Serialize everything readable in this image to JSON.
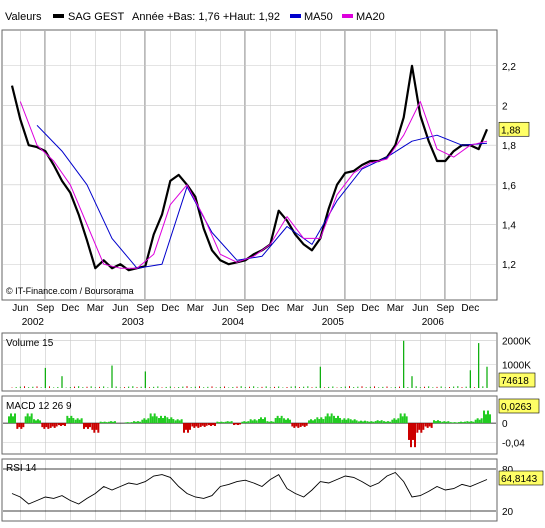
{
  "header": {
    "label": "Valeurs",
    "instrument": "SAG GEST",
    "range_text": "Année +Bas: 1,76 +Haut: 1,92",
    "ma50_label": "MA50",
    "ma20_label": "MA20"
  },
  "copyright": "© IT-Finance.com / Boursorama",
  "colors": {
    "price": "#000000",
    "ma50": "#0000cc",
    "ma20": "#dd00dd",
    "volume_up": "#00aa00",
    "volume_down": "#cc0000",
    "macd_pos": "#22cc22",
    "macd_neg": "#cc0000",
    "rsi": "#000000",
    "highlight_box": "#ffff66",
    "grid": "#c8c8c8",
    "year_divider": "#999999"
  },
  "chart_data": [
    {
      "name": "price",
      "type": "line",
      "x_axis": {
        "months": [
          "Jun",
          "Sep",
          "Dec",
          "Mar",
          "Jun",
          "Sep",
          "Dec",
          "Mar",
          "Jun",
          "Sep",
          "Dec",
          "Mar",
          "Jun",
          "Sep",
          "Dec",
          "Mar",
          "Jun",
          "Sep",
          "Dec"
        ],
        "years": [
          "2002",
          "2003",
          "2004",
          "2005",
          "2006"
        ],
        "xlim_month_index": [
          0,
          57
        ]
      },
      "y_axis": {
        "ticks": [
          "1,2",
          "1,4",
          "1,6",
          "1,8",
          "2",
          "2,2"
        ],
        "ylim": [
          1.04,
          2.36
        ]
      },
      "last_value_label": "1,88",
      "series": [
        {
          "name": "SAG GEST",
          "x": [
            0,
            1,
            2,
            3,
            4,
            5,
            6,
            7,
            8,
            9,
            10,
            11,
            12,
            13,
            14,
            15,
            16,
            17,
            18,
            19,
            20,
            21,
            22,
            23,
            24,
            25,
            26,
            27,
            28,
            29,
            30,
            31,
            32,
            33,
            34,
            35,
            36,
            37,
            38,
            39,
            40,
            41,
            42,
            43,
            44,
            45,
            46,
            47,
            48,
            49,
            50,
            51,
            52,
            53,
            54,
            55,
            56,
            57
          ],
          "values": [
            2.1,
            1.93,
            1.8,
            1.79,
            1.77,
            1.7,
            1.62,
            1.56,
            1.45,
            1.32,
            1.18,
            1.22,
            1.18,
            1.2,
            1.17,
            1.18,
            1.19,
            1.35,
            1.45,
            1.62,
            1.65,
            1.6,
            1.54,
            1.38,
            1.27,
            1.22,
            1.2,
            1.21,
            1.22,
            1.25,
            1.27,
            1.3,
            1.47,
            1.42,
            1.35,
            1.3,
            1.27,
            1.33,
            1.48,
            1.6,
            1.66,
            1.67,
            1.7,
            1.72,
            1.72,
            1.74,
            1.8,
            1.94,
            2.2,
            1.95,
            1.82,
            1.72,
            1.72,
            1.77,
            1.8,
            1.8,
            1.78,
            1.88
          ]
        },
        {
          "name": "MA50",
          "x": [
            3,
            6,
            9,
            12,
            15,
            18,
            21,
            24,
            27,
            30,
            33,
            36,
            39,
            42,
            45,
            48,
            51,
            54,
            57
          ],
          "values": [
            1.9,
            1.77,
            1.6,
            1.33,
            1.18,
            1.2,
            1.59,
            1.36,
            1.22,
            1.24,
            1.39,
            1.3,
            1.52,
            1.68,
            1.74,
            1.82,
            1.85,
            1.8,
            1.81
          ]
        },
        {
          "name": "MA20",
          "x": [
            1,
            3,
            5,
            7,
            9,
            11,
            13,
            15,
            17,
            19,
            21,
            23,
            25,
            27,
            29,
            31,
            33,
            35,
            37,
            39,
            41,
            43,
            45,
            47,
            49,
            51,
            53,
            55,
            57
          ],
          "values": [
            2.02,
            1.8,
            1.72,
            1.6,
            1.4,
            1.2,
            1.18,
            1.18,
            1.25,
            1.5,
            1.6,
            1.44,
            1.25,
            1.21,
            1.24,
            1.3,
            1.44,
            1.33,
            1.33,
            1.55,
            1.66,
            1.71,
            1.73,
            1.85,
            2.02,
            1.78,
            1.74,
            1.8,
            1.82
          ]
        }
      ]
    },
    {
      "name": "volume",
      "type": "bar",
      "title": "Volume 15",
      "y_axis": {
        "ticks": [
          "2000K",
          "1000K"
        ],
        "ylim": [
          0,
          2200
        ]
      },
      "last_value_label": "74618",
      "spikes": [
        {
          "x": 4,
          "value": 850
        },
        {
          "x": 6,
          "value": 500
        },
        {
          "x": 12,
          "value": 950
        },
        {
          "x": 16,
          "value": 700
        },
        {
          "x": 37,
          "value": 900
        },
        {
          "x": 47,
          "value": 2000
        },
        {
          "x": 48,
          "value": 500
        },
        {
          "x": 55,
          "value": 750
        },
        {
          "x": 56,
          "value": 1900
        },
        {
          "x": 57,
          "value": 900
        }
      ]
    },
    {
      "name": "macd",
      "type": "bar",
      "title": "MACD 12 26 9",
      "y_axis": {
        "ticks": [
          "0",
          "-0,04"
        ],
        "ylim": [
          -0.06,
          0.05
        ]
      },
      "last_value_label": "0,0263",
      "values": [
        0.02,
        -0.012,
        0.02,
        0.008,
        -0.012,
        -0.01,
        -0.006,
        0.015,
        0.01,
        -0.012,
        -0.02,
        0.003,
        0.004,
        0.0,
        0.002,
        0.004,
        0.01,
        0.02,
        0.015,
        0.012,
        0.008,
        -0.02,
        -0.01,
        -0.008,
        -0.006,
        0.003,
        0.004,
        -0.004,
        0.004,
        0.008,
        0.012,
        0.004,
        0.015,
        0.01,
        -0.01,
        -0.008,
        0.008,
        0.012,
        0.02,
        0.015,
        0.01,
        0.008,
        0.005,
        0.004,
        0.006,
        0.004,
        0.01,
        0.02,
        -0.05,
        -0.02,
        -0.01,
        0.006,
        0.004,
        0.002,
        0.003,
        0.004,
        0.01,
        0.026
      ]
    },
    {
      "name": "rsi",
      "type": "line",
      "title": "RSI 14",
      "y_axis": {
        "ticks": [
          "80",
          "20"
        ],
        "ylim": [
          10,
          90
        ]
      },
      "last_value_label": "64,8143",
      "values": [
        45,
        40,
        30,
        35,
        40,
        38,
        42,
        35,
        30,
        38,
        45,
        55,
        50,
        55,
        60,
        58,
        62,
        70,
        72,
        68,
        55,
        45,
        40,
        38,
        42,
        55,
        58,
        62,
        64,
        60,
        55,
        65,
        72,
        52,
        45,
        40,
        50,
        62,
        60,
        65,
        70,
        68,
        62,
        55,
        60,
        70,
        75,
        62,
        40,
        42,
        48,
        55,
        50,
        52,
        58,
        55,
        60,
        65
      ]
    }
  ]
}
